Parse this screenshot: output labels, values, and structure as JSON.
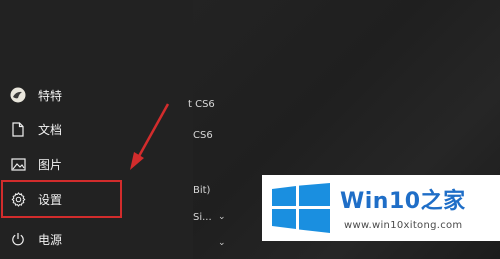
{
  "start_menu": {
    "user": {
      "name": "特特"
    },
    "documents_label": "文档",
    "pictures_label": "图片",
    "settings_label": "设置",
    "power_label": "电源"
  },
  "app_list": {
    "row1": "t CS6",
    "row2": "CS6",
    "row3": "Bit)",
    "row4": "Si..."
  },
  "watermark": {
    "title": "Win10",
    "title_zh": "之家",
    "url": "www.win10xitong.com"
  },
  "colors": {
    "highlight": "#d22c2c",
    "logo_blue": "#1f6ec7"
  }
}
